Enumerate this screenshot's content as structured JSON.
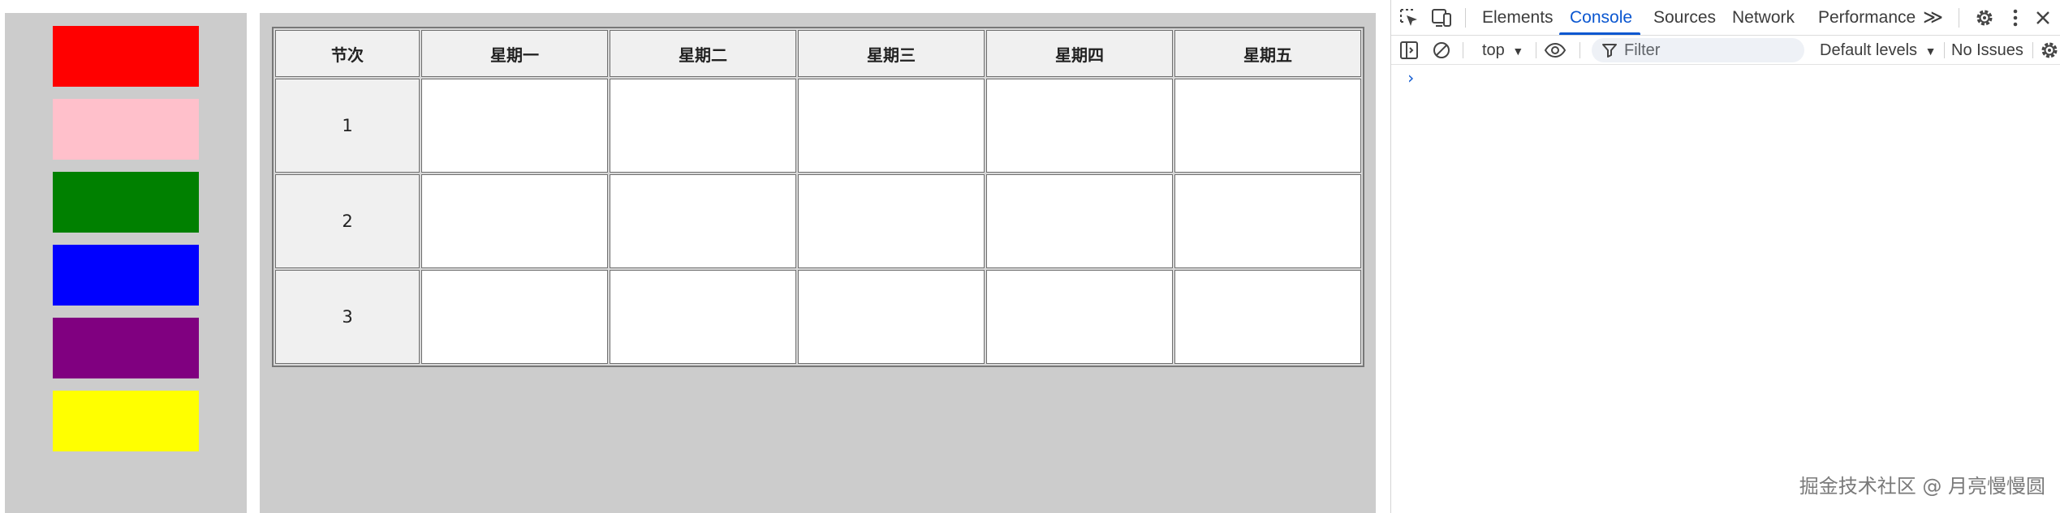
{
  "swatches": [
    {
      "name": "red",
      "color": "#ff0000"
    },
    {
      "name": "pink",
      "color": "#ffc0cb"
    },
    {
      "name": "green",
      "color": "#008000"
    },
    {
      "name": "blue",
      "color": "#0000ff"
    },
    {
      "name": "purple",
      "color": "#800080"
    },
    {
      "name": "yellow",
      "color": "#ffff00"
    }
  ],
  "schedule": {
    "headers": [
      "节次",
      "星期一",
      "星期二",
      "星期三",
      "星期四",
      "星期五"
    ],
    "periods": [
      "1",
      "2",
      "3"
    ]
  },
  "devtools": {
    "tabs": [
      "Elements",
      "Console",
      "Sources",
      "Network",
      "Performance"
    ],
    "active_tab": "Console",
    "more_tabs_glyph": "≫",
    "context": "top",
    "filter_placeholder": "Filter",
    "levels": "Default levels",
    "issues": "No Issues",
    "prompt": "›",
    "accent_color": "#0b57d0",
    "icons": [
      "inspect-element-icon",
      "device-toolbar-icon",
      "settings-gear-icon",
      "more-vertical-icon",
      "close-icon",
      "sidebar-toggle-icon",
      "clear-console-icon",
      "eye-icon",
      "filter-icon",
      "console-settings-gear-icon"
    ]
  },
  "watermark": "掘金技术社区 @ 月亮慢慢圆"
}
